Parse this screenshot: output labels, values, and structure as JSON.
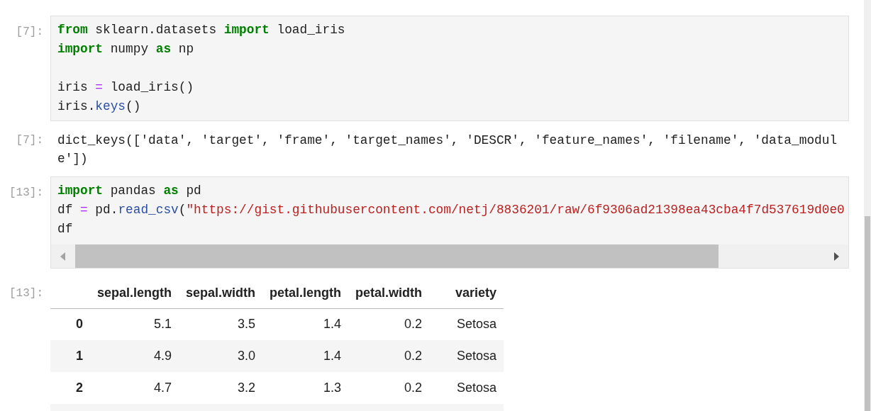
{
  "cells": [
    {
      "kind": "code",
      "prompt": "[7]:",
      "hscroll": false,
      "lines": [
        {
          "kind": "code",
          "tokens": [
            {
              "kind": "kw",
              "t": "from"
            },
            {
              "kind": "plain",
              "t": " sklearn.datasets "
            },
            {
              "kind": "kw",
              "t": "import"
            },
            {
              "kind": "plain",
              "t": " load_iris"
            }
          ]
        },
        {
          "kind": "code",
          "tokens": [
            {
              "kind": "kw",
              "t": "import"
            },
            {
              "kind": "plain",
              "t": " numpy "
            },
            {
              "kind": "kw",
              "t": "as"
            },
            {
              "kind": "plain",
              "t": " np"
            }
          ]
        },
        {
          "kind": "blank"
        },
        {
          "kind": "code",
          "tokens": [
            {
              "kind": "plain",
              "t": "iris "
            },
            {
              "kind": "op",
              "t": "="
            },
            {
              "kind": "plain",
              "t": " load_iris()"
            }
          ]
        },
        {
          "kind": "code",
          "tokens": [
            {
              "kind": "plain",
              "t": "iris."
            },
            {
              "kind": "attr",
              "t": "keys"
            },
            {
              "kind": "plain",
              "t": "()"
            }
          ]
        }
      ]
    },
    {
      "kind": "text",
      "prompt": "[7]:",
      "lines": [
        "dict_keys(['data', 'target', 'frame', 'target_names', 'DESCR', 'feature_names', 'filename', 'data_modul",
        "e'])"
      ]
    },
    {
      "kind": "code",
      "prompt": "[13]:",
      "hscroll": true,
      "lines": [
        {
          "kind": "code",
          "tokens": [
            {
              "kind": "kw",
              "t": "import"
            },
            {
              "kind": "plain",
              "t": " pandas "
            },
            {
              "kind": "kw",
              "t": "as"
            },
            {
              "kind": "plain",
              "t": " pd"
            }
          ]
        },
        {
          "kind": "code",
          "tokens": [
            {
              "kind": "plain",
              "t": "df "
            },
            {
              "kind": "op",
              "t": "="
            },
            {
              "kind": "plain",
              "t": " pd."
            },
            {
              "kind": "attr",
              "t": "read_csv"
            },
            {
              "kind": "plain",
              "t": "("
            },
            {
              "kind": "str",
              "t": "\"https://gist.githubusercontent.com/netj/8836201/raw/6f9306ad21398ea43cba4f7d537619d0e0"
            }
          ]
        },
        {
          "kind": "code",
          "tokens": [
            {
              "kind": "plain",
              "t": "df"
            }
          ]
        }
      ]
    },
    {
      "kind": "table",
      "prompt": "[13]:",
      "columns": [
        "",
        "sepal.length",
        "sepal.width",
        "petal.length",
        "petal.width",
        "variety"
      ],
      "rows": [
        [
          "0",
          "5.1",
          "3.5",
          "1.4",
          "0.2",
          "Setosa"
        ],
        [
          "1",
          "4.9",
          "3.0",
          "1.4",
          "0.2",
          "Setosa"
        ],
        [
          "2",
          "4.7",
          "3.2",
          "1.3",
          "0.2",
          "Setosa"
        ]
      ]
    }
  ]
}
